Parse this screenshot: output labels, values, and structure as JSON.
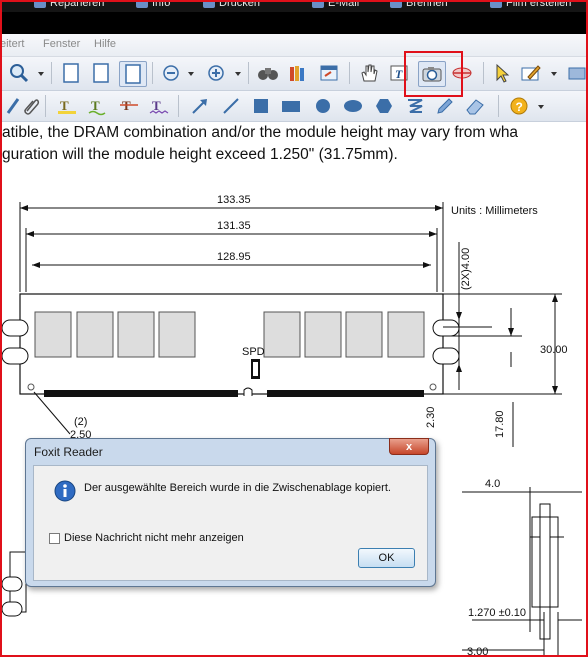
{
  "taskbar": {
    "items": [
      {
        "label": "Reparieren"
      },
      {
        "label": "Info"
      },
      {
        "label": "Drucken"
      },
      {
        "label": "E-Mail"
      },
      {
        "label": "Brennen"
      },
      {
        "label": "Film erstellen"
      }
    ]
  },
  "menubar": {
    "items": [
      {
        "label": "eitert"
      },
      {
        "label": "Fenster"
      },
      {
        "label": "Hilfe"
      }
    ]
  },
  "toolbar": {
    "snapshot_tool_icon": "camera-icon",
    "accent_color": "#e0101a"
  },
  "document": {
    "line1": "atible, the DRAM combination and/or the module height may vary from wha",
    "line2": "guration will the module height exceed 1.250\" (31.75mm).",
    "drawing": {
      "units": "Units : Millimeters",
      "dim1": "133.35",
      "dim2": "131.35",
      "dim3": "128.95",
      "dim_vertical_1": "(2X)4.00",
      "dim_height": "30.00",
      "spd_label": "SPD",
      "dim_bottom_left_count": "(2)",
      "dim_bottom_left": "2.50",
      "dim_small_vertical": "2.30",
      "dim_tall": "17.80",
      "side_dim_top": "4.0",
      "side_dim_mid": "1.270 ±0.10",
      "side_dim_bottom": "3.00"
    }
  },
  "dialog": {
    "title": "Foxit Reader",
    "close_label": "x",
    "message": "Der ausgewählte Bereich wurde in die Zwischenablage kopiert.",
    "checkbox_label": "Diese Nachricht nicht mehr anzeigen",
    "checkbox_checked": false,
    "ok_label": "OK"
  }
}
